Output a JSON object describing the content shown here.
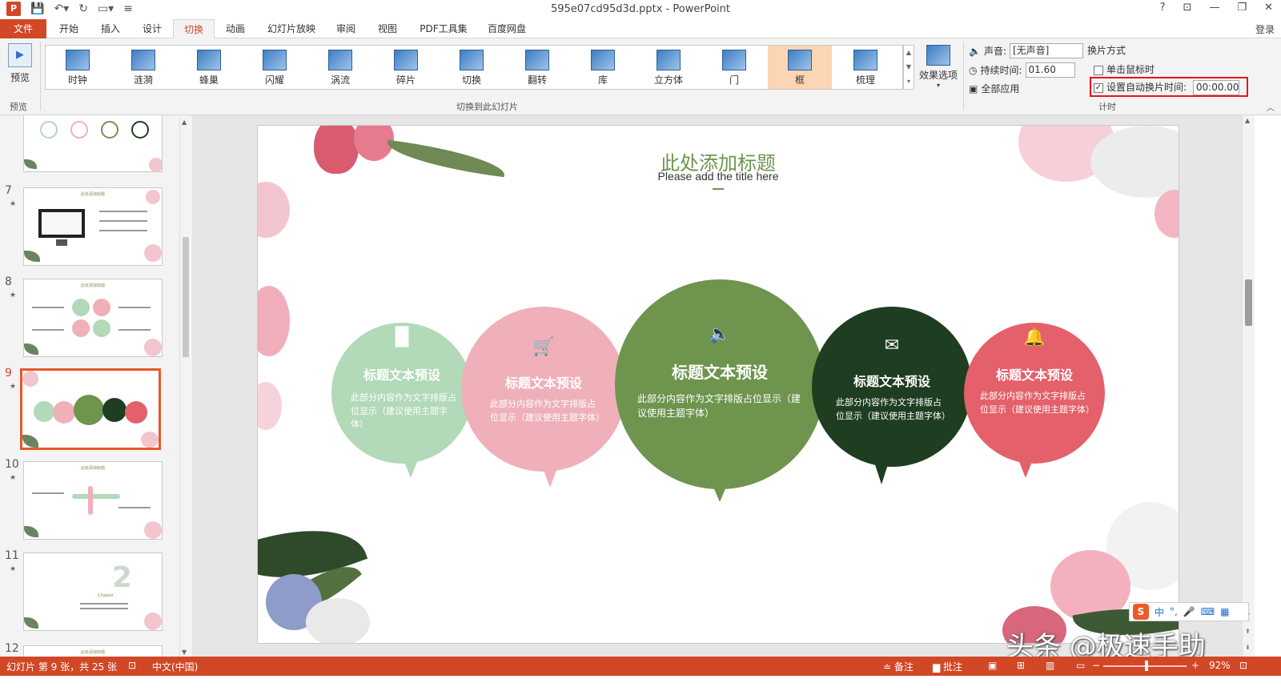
{
  "titlebar": {
    "app_icon": "P",
    "title": "595e07cd95d3d.pptx - PowerPoint",
    "help": "?",
    "restore_ribbon": "⊡",
    "minimize": "—",
    "maximize": "❐",
    "close": "✕"
  },
  "tabs": [
    "文件",
    "开始",
    "插入",
    "设计",
    "切换",
    "动画",
    "幻灯片放映",
    "审阅",
    "视图",
    "PDF工具集",
    "百度网盘"
  ],
  "active_tab": "切换",
  "login": "登录",
  "ribbon": {
    "preview_label": "预览",
    "preview_group": "预览",
    "transitions_group": "切换到此幻灯片",
    "transitions": [
      "时钟",
      "涟漪",
      "蜂巢",
      "闪耀",
      "涡流",
      "碎片",
      "切换",
      "翻转",
      "库",
      "立方体",
      "门",
      "框",
      "梳理"
    ],
    "selected_transition": "框",
    "effect_options": "效果选项",
    "sound_label": "声音:",
    "sound_value": "[无声音]",
    "duration_label": "持续时间:",
    "duration_value": "01.60",
    "apply_all": "全部应用",
    "advance_title": "换片方式",
    "on_click_label": "单击鼠标时",
    "on_click_checked": false,
    "auto_label": "设置自动换片时间:",
    "auto_checked": true,
    "auto_value": "00:00.00",
    "timing_group": "计时"
  },
  "thumbnails": [
    {
      "num": "",
      "star": "",
      "active": false,
      "partial": true
    },
    {
      "num": "7",
      "star": "★",
      "active": false
    },
    {
      "num": "8",
      "star": "★",
      "active": false
    },
    {
      "num": "9",
      "star": "★",
      "active": true
    },
    {
      "num": "10",
      "star": "★",
      "active": false
    },
    {
      "num": "11",
      "star": "★",
      "active": false
    },
    {
      "num": "12",
      "star": "",
      "active": false
    }
  ],
  "slide": {
    "title": "此处添加标题",
    "subtitle": "Please add the title here",
    "bubbles": [
      {
        "icon": "bar-chart-icon",
        "glyph": "▐▌",
        "title": "标题文本预设",
        "body": "此部分内容作为文字排版占位显示（建议使用主题字体）",
        "color": "#b2d9b8"
      },
      {
        "icon": "cart-icon",
        "glyph": "🛒",
        "title": "标题文本预设",
        "body": "此部分内容作为文字排版占位显示（建议使用主题字体）",
        "color": "#efb0b9"
      },
      {
        "icon": "speaker-icon",
        "glyph": "🔈",
        "title": "标题文本预设",
        "body": "此部分内容作为文字排版占位显示（建议使用主题字体）",
        "color": "#6e944e"
      },
      {
        "icon": "envelope-icon",
        "glyph": "✉",
        "title": "标题文本预设",
        "body": "此部分内容作为文字排版占位显示（建议使用主题字体）",
        "color": "#1f3d20"
      },
      {
        "icon": "bell-icon",
        "glyph": "🔔",
        "title": "标题文本预设",
        "body": "此部分内容作为文字排版占位显示（建议使用主题字体）",
        "color": "#e4606a"
      }
    ]
  },
  "ime": {
    "logo": "S",
    "lang": "中",
    "punct": "°,",
    "mic": "🎤",
    "keyboard": "⌨",
    "grid": "▦"
  },
  "watermark": "头条 @极速手助",
  "status": {
    "slide_info": "幻灯片 第 9 张，共 25 张",
    "lang": "中文(中国)",
    "notes": "≐ 备注",
    "comments": "▆ 批注",
    "zoom": "92%",
    "zoom_minus": "−",
    "zoom_plus": "+"
  }
}
